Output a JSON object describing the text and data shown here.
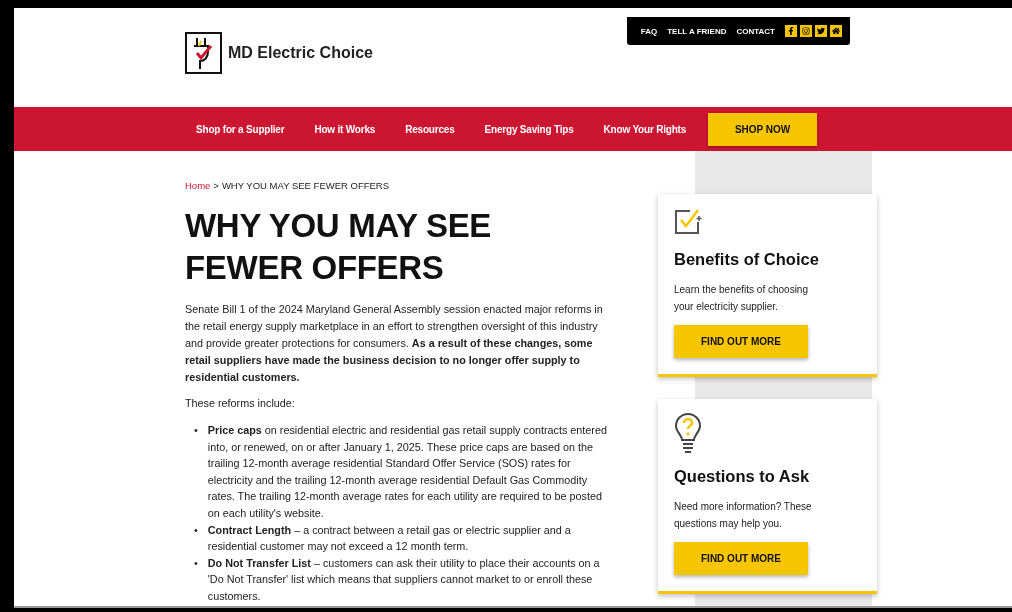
{
  "site": {
    "name": "MD Electric Choice"
  },
  "utility_links": [
    "FAQ",
    "TELL A FRIEND",
    "CONTACT"
  ],
  "social_icons": [
    {
      "kind": "facebook"
    },
    {
      "kind": "instagram"
    },
    {
      "kind": "twitter"
    },
    {
      "kind": "home"
    }
  ],
  "nav": {
    "items": [
      "Shop for a Supplier",
      "How it Works",
      "Resources",
      "Energy Saving Tips",
      "Know Your Rights"
    ],
    "cta": "SHOP NOW"
  },
  "breadcrumb": {
    "home": "Home",
    "separator": ">",
    "current": "WHY YOU MAY SEE FEWER OFFERS"
  },
  "article": {
    "title": "WHY YOU MAY SEE FEWER OFFERS",
    "intro": "Senate Bill 1 of the 2024 Maryland General Assembly session enacted major reforms in the retail energy supply marketplace in an effort to strengthen oversight of this industry and provide greater protections for consumers. **As a result of these changes, some retail suppliers have made the business decision to no longer offer supply to residential customers.**",
    "list_intro": "These reforms include:",
    "bullet_marker": "•",
    "bullets": [
      "**Price caps** on residential electric and residential gas retail supply contracts entered into, or renewed, on or after January 1, 2025. These price caps are based on the trailing 12-month average residential Standard Offer Service (SOS) rates for electricity and the trailing 12-month average residential Default Gas Commodity rates. The trailing 12-month average rates for each utility are required to be posted on each utility's website.",
      "**Contract Length** – a contract between a retail gas or electric supplier and a residential customer may not exceed a 12 month term.",
      "**Do Not Transfer List** – customers can ask their utility to place their accounts on a 'Do Not Transfer' list which means that suppliers cannot market to or enroll these customers."
    ]
  },
  "sidebar_cards": [
    {
      "kind": "checkbox",
      "title": "Benefits of Choice",
      "text": "Learn the benefits of choosing your electricity supplier.",
      "button": "FIND OUT MORE"
    },
    {
      "kind": "bulb",
      "title": "Questions to Ask",
      "text": "Need more information? These questions may help you.",
      "button": "FIND OUT MORE"
    }
  ]
}
